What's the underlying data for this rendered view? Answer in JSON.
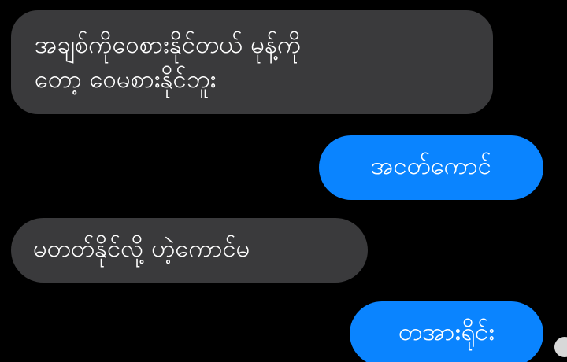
{
  "messages": [
    {
      "direction": "incoming",
      "text": "အချစ်ကိုဝေစားနိုင်တယ် မုန့်ကို\nတော့ ဝေမစားနိုင်ဘူး"
    },
    {
      "direction": "outgoing",
      "text": "အငတ်ကောင်"
    },
    {
      "direction": "incoming",
      "text": "မတတ်နိုင်လို့ ဟဲ့ကောင်မ"
    },
    {
      "direction": "outgoing",
      "text": "တအားရိုင်း"
    }
  ],
  "colors": {
    "background": "#000000",
    "incoming_bubble": "#3a3a3c",
    "outgoing_bubble": "#0a84ff",
    "text": "#ffffff"
  }
}
